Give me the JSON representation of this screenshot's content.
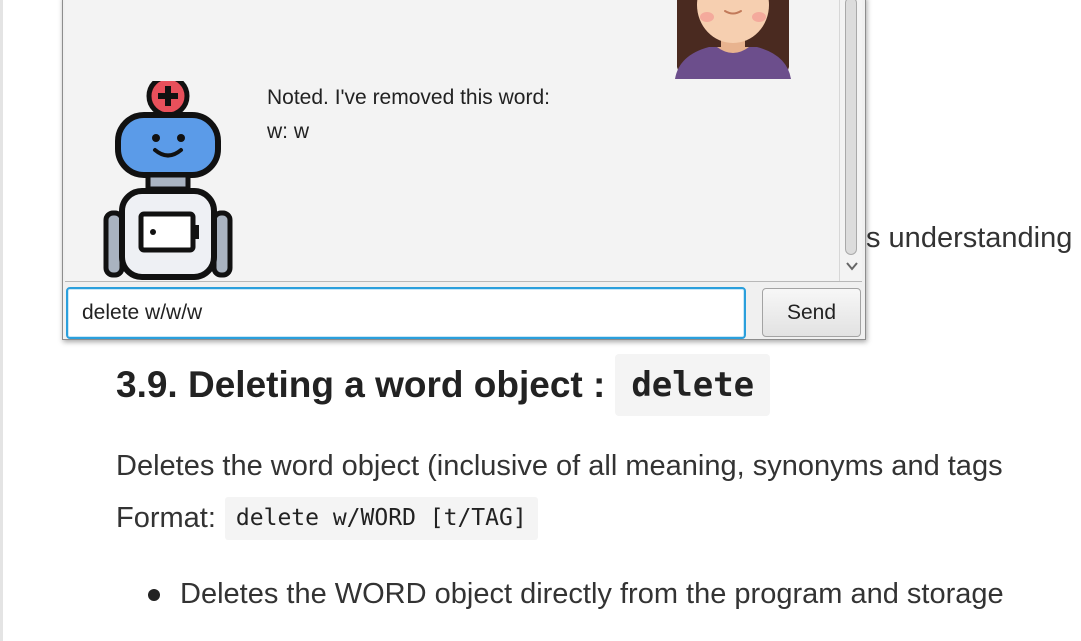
{
  "document": {
    "partial_text": "s understanding",
    "section_number": "3.9.",
    "section_title": "Deleting a word object :",
    "section_code": "delete",
    "description": "Deletes the word object (inclusive of all meaning, synonyms and tags",
    "format_label": "Format:",
    "format_code": "delete w/WORD [t/TAG]",
    "bullets": [
      "Deletes the WORD object directly from the program and storage"
    ]
  },
  "chat": {
    "bot_message_lines": [
      "Noted. I've removed this word:",
      "w: w"
    ],
    "user_avatar": "user-avatar-icon",
    "bot_avatar": "robot-avatar-icon"
  },
  "input": {
    "value": "delete w/w/w"
  },
  "send_button": {
    "label": "Send"
  },
  "colors": {
    "input_focus_border": "#2a9fdc",
    "robot_head": "#5b9be8",
    "robot_badge": "#e8505b",
    "user_hair": "#4a2a20",
    "user_shirt": "#6c4e8c"
  }
}
